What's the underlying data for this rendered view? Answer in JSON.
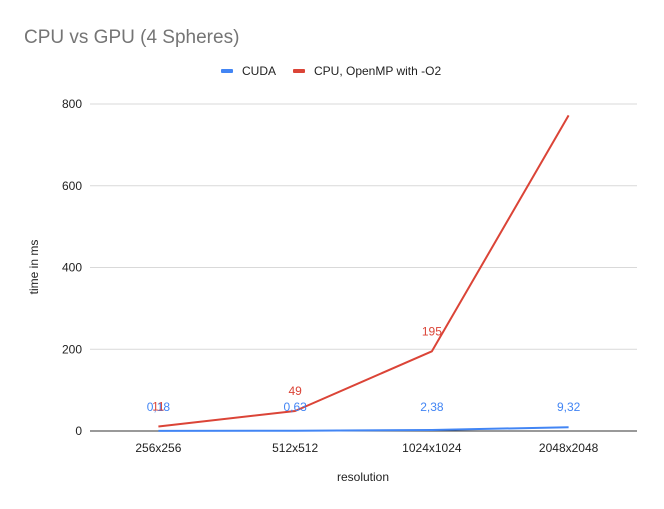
{
  "chart_data": {
    "type": "line",
    "title": "CPU vs GPU (4 Spheres)",
    "xlabel": "resolution",
    "ylabel": "time in ms",
    "categories": [
      "256x256",
      "512x512",
      "1024x1024",
      "2048x2048"
    ],
    "ylim": [
      0,
      800
    ],
    "yticks": [
      "0",
      "200",
      "400",
      "600",
      "800"
    ],
    "grid": true,
    "legend_position": "top",
    "series": [
      {
        "name": "CUDA",
        "color": "#4285f4",
        "values": [
          0.18,
          0.63,
          2.38,
          9.32
        ],
        "data_labels": [
          "0,18",
          "0,63",
          "2,38",
          "9,32"
        ]
      },
      {
        "name": "CPU, OpenMP with -O2",
        "color": "#db4437",
        "values": [
          11,
          49,
          195,
          772
        ],
        "data_labels": [
          "11",
          "49",
          "195",
          ""
        ]
      }
    ]
  }
}
